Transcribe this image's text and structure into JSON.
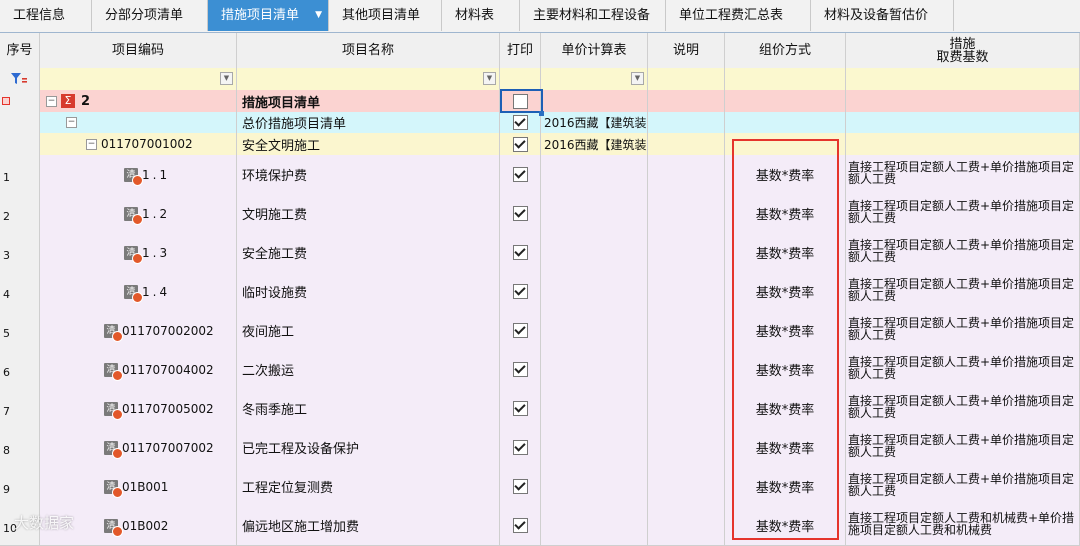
{
  "tabs": [
    {
      "label": "工程信息"
    },
    {
      "label": "分部分项清单"
    },
    {
      "label": "措施项目清单",
      "active": true
    },
    {
      "label": "其他项目清单"
    },
    {
      "label": "材料表"
    },
    {
      "label": "主要材料和工程设备"
    },
    {
      "label": "单位工程费汇总表"
    },
    {
      "label": "材料及设备暂估价"
    }
  ],
  "columns": {
    "seq": "序号",
    "code": "项目编码",
    "name": "项目名称",
    "print": "打印",
    "unit_calc": "单价计算表",
    "desc": "说明",
    "pricing": "组价方式",
    "basis": "措施\n取费基数"
  },
  "filter_icon": "filter-icon",
  "rows": [
    {
      "seq": "",
      "code": "2",
      "name": "措施项目清单",
      "print": false,
      "unit_calc": "",
      "pricing": "",
      "basis": "",
      "type": "top"
    },
    {
      "seq": "",
      "code": "",
      "name": "总价措施项目清单",
      "print": true,
      "unit_calc": "2016西藏【建筑装",
      "pricing": "",
      "basis": "",
      "type": "sub"
    },
    {
      "seq": "",
      "code": "011707001002",
      "name": "安全文明施工",
      "print": true,
      "unit_calc": "2016西藏【建筑装",
      "pricing": "",
      "basis": "",
      "type": "sec"
    },
    {
      "seq": "1",
      "code": "1.1",
      "name": "环境保护费",
      "print": true,
      "unit_calc": "",
      "pricing": "基数*费率",
      "basis": "直接工程项目定额人工费+单价措施项目定额人工费"
    },
    {
      "seq": "2",
      "code": "1.2",
      "name": "文明施工费",
      "print": true,
      "unit_calc": "",
      "pricing": "基数*费率",
      "basis": "直接工程项目定额人工费+单价措施项目定额人工费"
    },
    {
      "seq": "3",
      "code": "1.3",
      "name": "安全施工费",
      "print": true,
      "unit_calc": "",
      "pricing": "基数*费率",
      "basis": "直接工程项目定额人工费+单价措施项目定额人工费"
    },
    {
      "seq": "4",
      "code": "1.4",
      "name": "临时设施费",
      "print": true,
      "unit_calc": "",
      "pricing": "基数*费率",
      "basis": "直接工程项目定额人工费+单价措施项目定额人工费"
    },
    {
      "seq": "5",
      "code": "011707002002",
      "name": "夜间施工",
      "print": true,
      "unit_calc": "",
      "pricing": "基数*费率",
      "basis": "直接工程项目定额人工费+单价措施项目定额人工费"
    },
    {
      "seq": "6",
      "code": "011707004002",
      "name": "二次搬运",
      "print": true,
      "unit_calc": "",
      "pricing": "基数*费率",
      "basis": "直接工程项目定额人工费+单价措施项目定额人工费"
    },
    {
      "seq": "7",
      "code": "011707005002",
      "name": "冬雨季施工",
      "print": true,
      "unit_calc": "",
      "pricing": "基数*费率",
      "basis": "直接工程项目定额人工费+单价措施项目定额人工费"
    },
    {
      "seq": "8",
      "code": "011707007002",
      "name": "已完工程及设备保护",
      "print": true,
      "unit_calc": "",
      "pricing": "基数*费率",
      "basis": "直接工程项目定额人工费+单价措施项目定额人工费"
    },
    {
      "seq": "9",
      "code": "01B001",
      "name": "工程定位复测费",
      "print": true,
      "unit_calc": "",
      "pricing": "基数*费率",
      "basis": "直接工程项目定额人工费+单价措施项目定额人工费"
    },
    {
      "seq": "10",
      "code": "01B002",
      "name": "偏远地区施工增加费",
      "print": true,
      "unit_calc": "",
      "pricing": "基数*费率",
      "basis": "直接工程项目定额人工费和机械费+单价措施项目定额人工费和机械费"
    }
  ],
  "watermark": "大数据家",
  "colors": {
    "active_tab": "#3c8fd3",
    "highlight_box": "#e5342c",
    "top_row": "#fbd3d1",
    "sub_row": "#d4f6fb",
    "sec_row": "#fbf6cf",
    "item_row": "#f4ecf8"
  }
}
